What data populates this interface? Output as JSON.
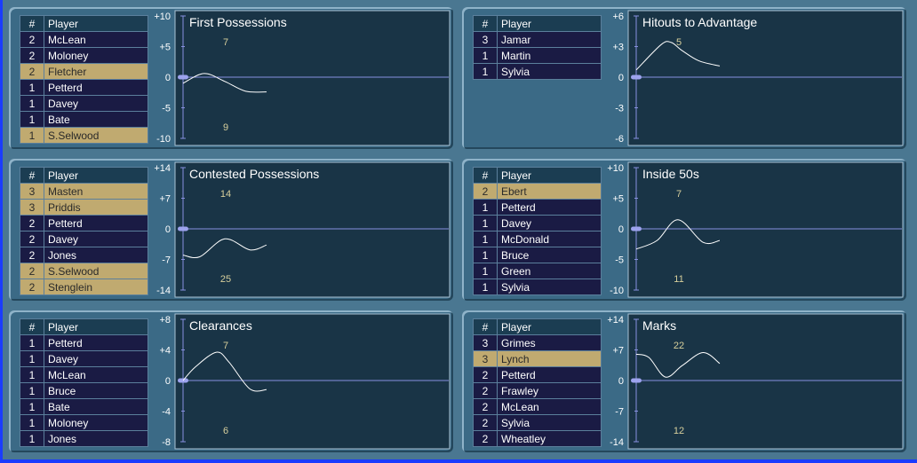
{
  "columns": {
    "num": "#",
    "player": "Player"
  },
  "theme": {
    "chart_bg": "#193446",
    "highlight_row": "#c0aa70",
    "normal_row": "#1a1b44",
    "axis": "#8890e0",
    "line": "#ffffff"
  },
  "panels": [
    {
      "rows": [
        {
          "num": "2",
          "player": "McLean",
          "highlight": false
        },
        {
          "num": "2",
          "player": "Moloney",
          "highlight": false
        },
        {
          "num": "2",
          "player": "Fletcher",
          "highlight": true
        },
        {
          "num": "1",
          "player": "Petterd",
          "highlight": false
        },
        {
          "num": "1",
          "player": "Davey",
          "highlight": false
        },
        {
          "num": "1",
          "player": "Bate",
          "highlight": false
        },
        {
          "num": "1",
          "player": "S.Selwood",
          "highlight": true
        }
      ]
    },
    {
      "rows": [
        {
          "num": "3",
          "player": "Jamar",
          "highlight": false
        },
        {
          "num": "1",
          "player": "Martin",
          "highlight": false
        },
        {
          "num": "1",
          "player": "Sylvia",
          "highlight": false
        }
      ]
    },
    {
      "rows": [
        {
          "num": "3",
          "player": "Masten",
          "highlight": true
        },
        {
          "num": "3",
          "player": "Priddis",
          "highlight": true
        },
        {
          "num": "2",
          "player": "Petterd",
          "highlight": false
        },
        {
          "num": "2",
          "player": "Davey",
          "highlight": false
        },
        {
          "num": "2",
          "player": "Jones",
          "highlight": false
        },
        {
          "num": "2",
          "player": "S.Selwood",
          "highlight": true
        },
        {
          "num": "2",
          "player": "Stenglein",
          "highlight": true
        }
      ]
    },
    {
      "rows": [
        {
          "num": "2",
          "player": "Ebert",
          "highlight": true
        },
        {
          "num": "1",
          "player": "Petterd",
          "highlight": false
        },
        {
          "num": "1",
          "player": "Davey",
          "highlight": false
        },
        {
          "num": "1",
          "player": "McDonald",
          "highlight": false
        },
        {
          "num": "1",
          "player": "Bruce",
          "highlight": false
        },
        {
          "num": "1",
          "player": "Green",
          "highlight": false
        },
        {
          "num": "1",
          "player": "Sylvia",
          "highlight": false
        }
      ]
    },
    {
      "rows": [
        {
          "num": "1",
          "player": "Petterd",
          "highlight": false
        },
        {
          "num": "1",
          "player": "Davey",
          "highlight": false
        },
        {
          "num": "1",
          "player": "McLean",
          "highlight": false
        },
        {
          "num": "1",
          "player": "Bruce",
          "highlight": false
        },
        {
          "num": "1",
          "player": "Bate",
          "highlight": false
        },
        {
          "num": "1",
          "player": "Moloney",
          "highlight": false
        },
        {
          "num": "1",
          "player": "Jones",
          "highlight": false
        }
      ]
    },
    {
      "rows": [
        {
          "num": "3",
          "player": "Grimes",
          "highlight": false
        },
        {
          "num": "3",
          "player": "Lynch",
          "highlight": true
        },
        {
          "num": "2",
          "player": "Petterd",
          "highlight": false
        },
        {
          "num": "2",
          "player": "Frawley",
          "highlight": false
        },
        {
          "num": "2",
          "player": "McLean",
          "highlight": false
        },
        {
          "num": "2",
          "player": "Sylvia",
          "highlight": false
        },
        {
          "num": "2",
          "player": "Wheatley",
          "highlight": false
        }
      ]
    }
  ],
  "chart_data": [
    {
      "type": "line",
      "title": "First Possessions",
      "ylim": [
        -10,
        10
      ],
      "tick_labels": [
        "+10",
        "+5",
        "0",
        "-5",
        "-10"
      ],
      "top_value": "7",
      "bottom_value": "9",
      "x": [
        0,
        0.25,
        0.5,
        0.75,
        1
      ],
      "values": [
        -1,
        0.6,
        -0.7,
        -2.3,
        -2.4
      ]
    },
    {
      "type": "line",
      "title": "Hitouts to Advantage",
      "ylim": [
        -6,
        6
      ],
      "tick_labels": [
        "+6",
        "+3",
        "0",
        "-3",
        "-6"
      ],
      "top_value": "5",
      "bottom_value": "",
      "x": [
        0,
        0.3,
        0.42,
        0.55,
        0.75,
        1
      ],
      "values": [
        0.7,
        3.2,
        3.4,
        2.6,
        1.6,
        1.1
      ]
    },
    {
      "type": "line",
      "title": "Contested Possessions",
      "ylim": [
        -14,
        14
      ],
      "tick_labels": [
        "+14",
        "+7",
        "0",
        "-7",
        "-14"
      ],
      "top_value": "14",
      "bottom_value": "25",
      "x": [
        0,
        0.2,
        0.5,
        0.8,
        1
      ],
      "values": [
        -6,
        -6.4,
        -2.3,
        -4.8,
        -3.7
      ]
    },
    {
      "type": "line",
      "title": "Inside 50s",
      "ylim": [
        -10,
        10
      ],
      "tick_labels": [
        "+10",
        "+5",
        "0",
        "-5",
        "-10"
      ],
      "top_value": "7",
      "bottom_value": "11",
      "x": [
        0,
        0.25,
        0.5,
        0.8,
        1
      ],
      "values": [
        -3.3,
        -1.9,
        1.5,
        -2.2,
        -1.9
      ]
    },
    {
      "type": "line",
      "title": "Clearances",
      "ylim": [
        -8,
        8
      ],
      "tick_labels": [
        "+8",
        "+4",
        "0",
        "-4",
        "-8"
      ],
      "top_value": "7",
      "bottom_value": "6",
      "x": [
        0,
        0.15,
        0.4,
        0.55,
        0.8,
        1
      ],
      "values": [
        0,
        1.8,
        3.7,
        2.4,
        -1.1,
        -1.2
      ]
    },
    {
      "type": "line",
      "title": "Marks",
      "ylim": [
        -14,
        14
      ],
      "tick_labels": [
        "+14",
        "+7",
        "0",
        "-7",
        "-14"
      ],
      "top_value": "22",
      "bottom_value": "12",
      "x": [
        0,
        0.15,
        0.35,
        0.55,
        0.8,
        1
      ],
      "values": [
        6,
        5.3,
        0.8,
        3.4,
        6.4,
        3.9
      ]
    }
  ]
}
